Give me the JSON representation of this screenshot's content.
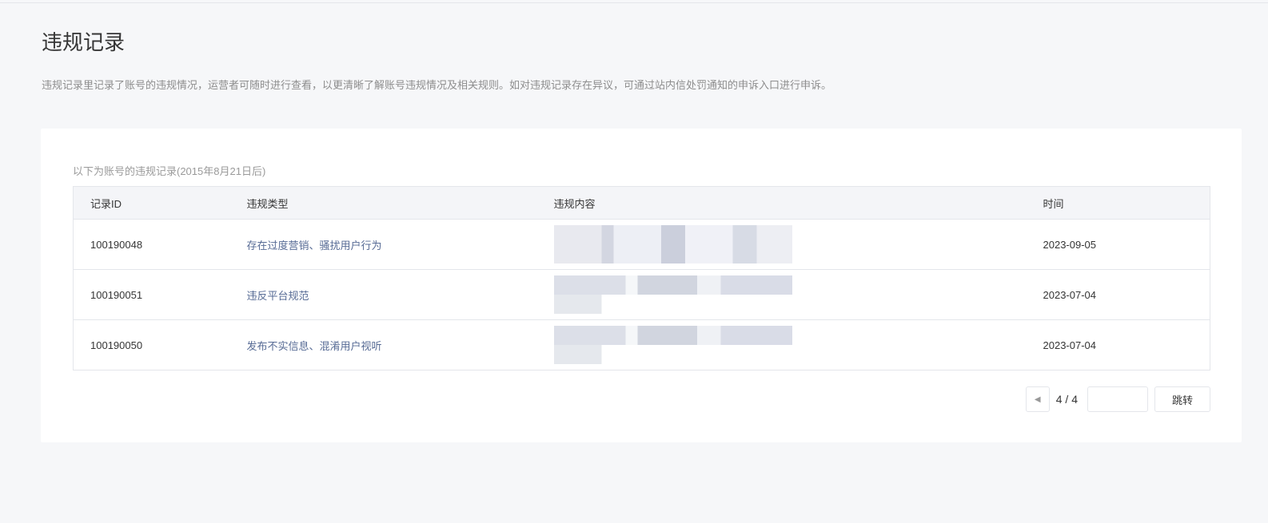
{
  "page": {
    "title": "违规记录",
    "description": "违规记录里记录了账号的违规情况，运营者可随时进行查看，以更清晰了解账号违规情况及相关规则。如对违规记录存在异议，可通过站内信处罚通知的申诉入口进行申诉。"
  },
  "card": {
    "subtitle": "以下为账号的违规记录(2015年8月21日后)"
  },
  "table": {
    "headers": [
      "记录ID",
      "违规类型",
      "违规内容",
      "时间"
    ],
    "rows": [
      {
        "id": "100190048",
        "type": "存在过度营销、骚扰用户行为",
        "time": "2023-09-05"
      },
      {
        "id": "100190051",
        "type": "违反平台规范",
        "time": "2023-07-04"
      },
      {
        "id": "100190050",
        "type": "发布不实信息、混淆用户视听",
        "time": "2023-07-04"
      }
    ]
  },
  "pager": {
    "current": "4 / 4",
    "jump_label": "跳转",
    "prev_icon": "caret-left-icon"
  },
  "colors": {
    "link": "#576b95",
    "background": "#f6f7f9"
  }
}
